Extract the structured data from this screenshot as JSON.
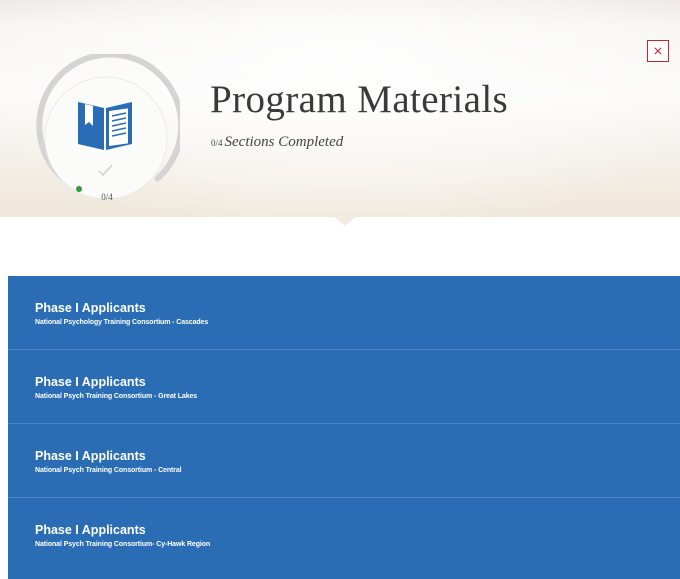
{
  "header": {
    "title": "Program Materials",
    "progress_count": "0/4",
    "progress_text": "Sections Completed",
    "ring_label": "0/4",
    "progress_value": 0,
    "icon": "book-icon"
  },
  "close": {
    "icon": "close-icon"
  },
  "sections": [
    {
      "title": "Phase I Applicants",
      "subtitle": "National Psychology Training Consortium - Cascades"
    },
    {
      "title": "Phase I Applicants",
      "subtitle": "National Psych Training Consortium - Great Lakes"
    },
    {
      "title": "Phase I Applicants",
      "subtitle": "National Psych Training Consortium - Central"
    },
    {
      "title": "Phase I Applicants",
      "subtitle": "National Psych Training Consortium- Cy-Hawk Region"
    }
  ],
  "colors": {
    "accent": "#2a6db5",
    "progress_dot": "#2e9d3a",
    "close": "#c62828",
    "book": "#2a6db5"
  }
}
